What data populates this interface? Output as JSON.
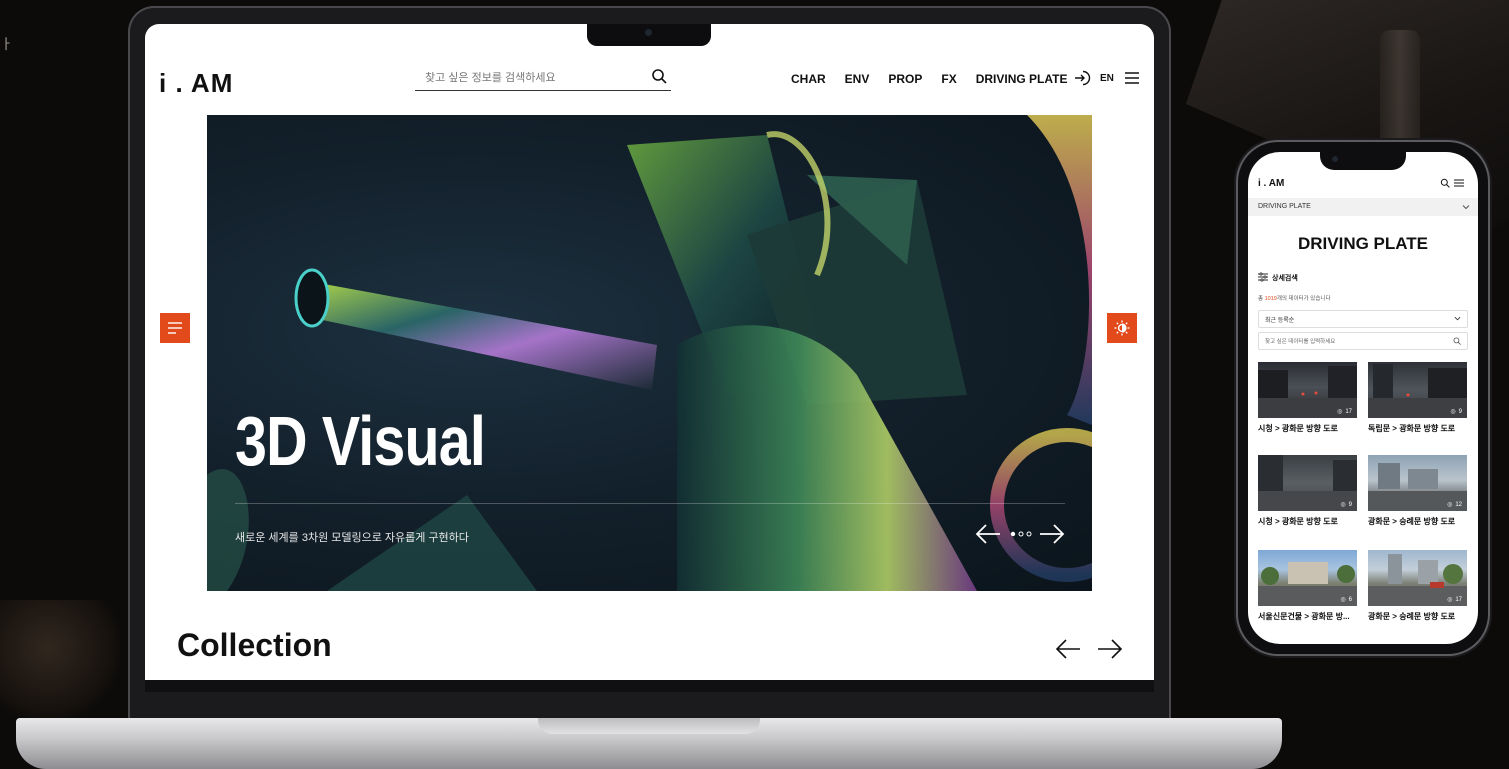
{
  "corner_glyph": "ㅏ",
  "laptop": {
    "logo": "i . AM",
    "search_placeholder": "찾고 싶은 정보를 검색하세요",
    "nav": [
      "CHAR",
      "ENV",
      "PROP",
      "FX",
      "DRIVING PLATE"
    ],
    "lang": "EN",
    "hero": {
      "title": "3D Visual",
      "subtitle": "새로운 세계를 3차원 모델링으로 자유롭게 구현하다"
    },
    "collection_title": "Collection"
  },
  "phone": {
    "logo": "i . AM",
    "breadcrumb": "DRIVING PLATE",
    "title": "DRIVING PLATE",
    "filter_label": "상세검색",
    "count_prefix": "총 ",
    "count_number": "1019",
    "count_suffix": "개의 데이터가 있습니다",
    "sort_label": "최근 등록순",
    "search_placeholder": "찾고 싶은 데이터를 입력하세요",
    "cards": [
      {
        "caption": "시청 > 광화문 방향 도로",
        "views": "17"
      },
      {
        "caption": "독립문 > 광화문 방향 도로",
        "views": "9"
      },
      {
        "caption": "시청 > 광화문 방향 도로",
        "views": "9"
      },
      {
        "caption": "광화문 > 숭례문 방향 도로",
        "views": "12"
      },
      {
        "caption": "서울신문건물 > 광화문 방...",
        "views": "6"
      },
      {
        "caption": "광화문 > 숭례문 방향 도로",
        "views": "17"
      }
    ]
  },
  "colors": {
    "accent": "#e24a1c",
    "page_bg": "#0c0b0a",
    "hero_bg": "#13212c"
  }
}
